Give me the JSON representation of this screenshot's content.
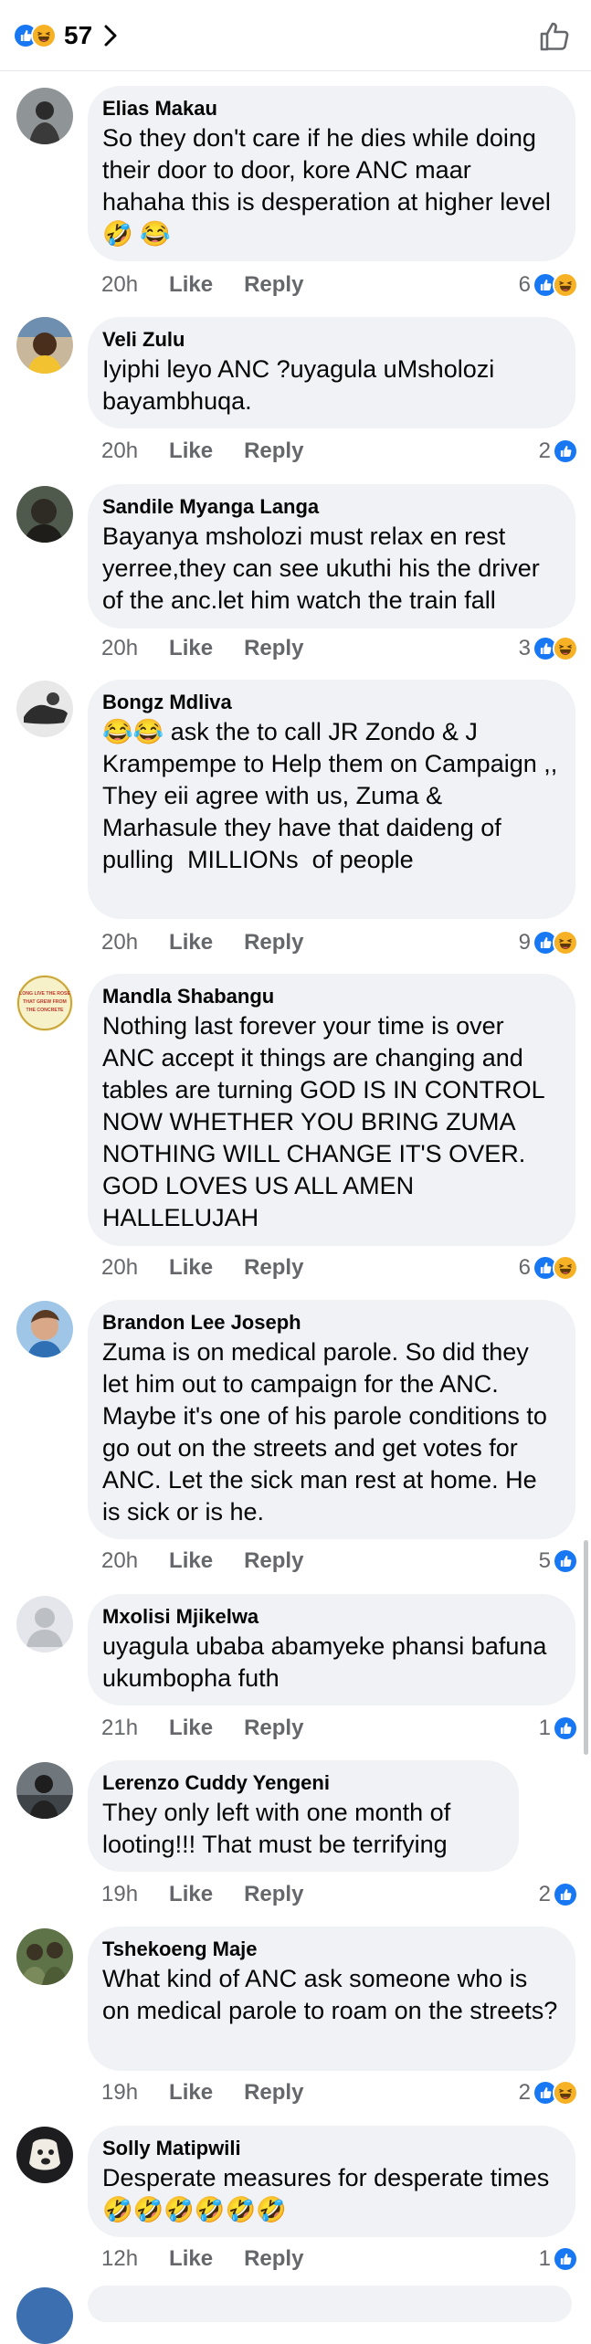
{
  "header": {
    "reaction_count": "57",
    "reactions": [
      "like-icon",
      "haha-icon"
    ]
  },
  "colors": {
    "like_blue": "#1877f2",
    "haha_yellow": "#f7b125",
    "bubble_bg": "#f0f2f5",
    "meta_gray": "#65676b"
  },
  "actions": {
    "like": "Like",
    "reply": "Reply"
  },
  "comments": [
    {
      "name": "Elias Makau",
      "text": "So they don't care if he dies while doing their door to door, kore ANC maar hahaha this is desperation at higher level 🤣 😂",
      "time": "20h",
      "reaction_count": "6",
      "reactions": [
        "like",
        "haha"
      ]
    },
    {
      "name": "Veli Zulu",
      "text": "Iyiphi leyo ANC ?uyagula uMsholozi bayambhuqa.",
      "time": "20h",
      "reaction_count": "2",
      "reactions": [
        "like"
      ]
    },
    {
      "name": "Sandile Myanga Langa",
      "text": "Bayanya msholozi must relax en rest yerree,they can see ukuthi his the driver of the anc.let him watch the train fall",
      "time": "20h",
      "reaction_count": "3",
      "reactions": [
        "like",
        "haha"
      ]
    },
    {
      "name": "Bongz Mdliva",
      "text": "😂😂 ask the to call JR Zondo & J Krampempe to Help them on Campaign ,,\nThey eii agree with us, Zuma & Marhasule they have that daideng of pulling  MILLIONs  of people",
      "time": "20h",
      "reaction_count": "9",
      "reactions": [
        "like",
        "haha"
      ]
    },
    {
      "name": "Mandla Shabangu",
      "text": "Nothing last forever your time is over ANC accept it things are changing and tables are turning GOD IS IN CONTROL NOW WHETHER YOU BRING ZUMA NOTHING WILL CHANGE IT'S OVER. GOD LOVES US ALL AMEN HALLELUJAH",
      "time": "20h",
      "reaction_count": "6",
      "reactions": [
        "like",
        "haha"
      ],
      "avatar_text": [
        "LONG LIVE THE ROSE",
        "THAT GREW FROM",
        "THE CONCRETE"
      ]
    },
    {
      "name": "Brandon Lee Joseph",
      "text": "Zuma is on medical parole. So did they let him out to campaign for the ANC. Maybe it's one of his parole conditions to go out on the streets and get votes for ANC. Let the sick man rest at home. He is sick or is he.",
      "time": "20h",
      "reaction_count": "5",
      "reactions": [
        "like"
      ]
    },
    {
      "name": "Mxolisi Mjikelwa",
      "text": "uyagula ubaba abamyeke phansi bafuna ukumbopha futh",
      "time": "21h",
      "reaction_count": "1",
      "reactions": [
        "like"
      ]
    },
    {
      "name": "Lerenzo Cuddy Yengeni",
      "text": "They only left with one month of looting!!! That must be terrifying",
      "time": "19h",
      "reaction_count": "2",
      "reactions": [
        "like"
      ]
    },
    {
      "name": "Tshekoeng Maje",
      "text": "What kind of ANC ask someone who is on medical parole to roam on the streets?",
      "time": "19h",
      "reaction_count": "2",
      "reactions": [
        "like",
        "haha"
      ]
    },
    {
      "name": "Solly Matipwili",
      "text": "Desperate measures for desperate times 🤣🤣🤣🤣🤣🤣",
      "time": "12h",
      "reaction_count": "1",
      "reactions": [
        "like"
      ]
    }
  ]
}
